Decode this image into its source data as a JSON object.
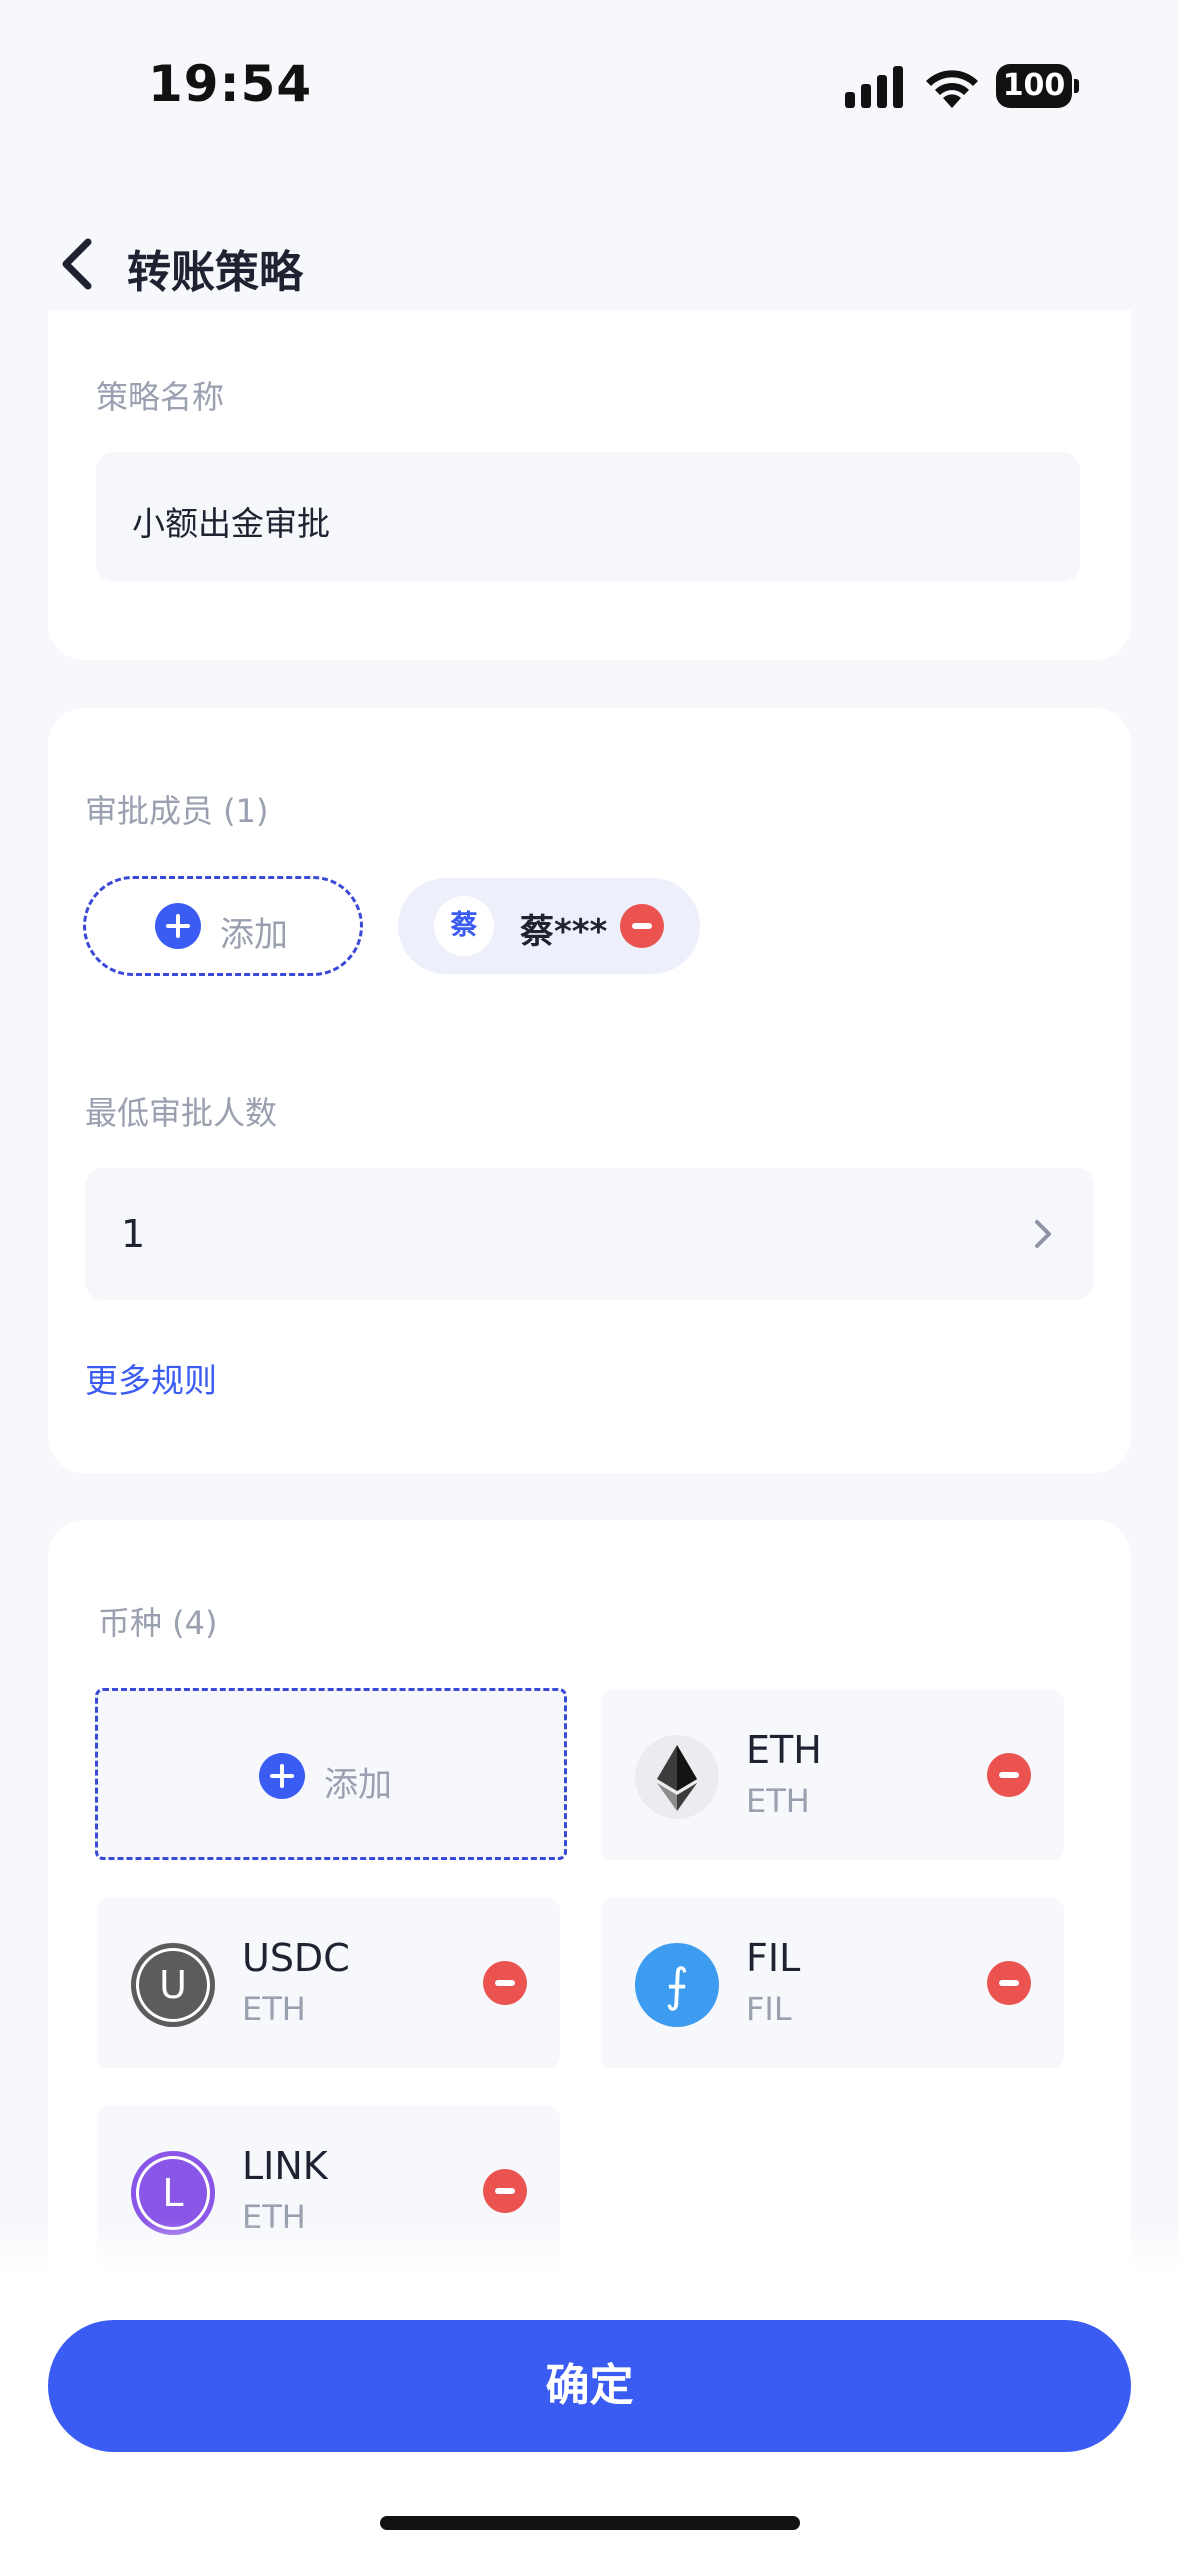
{
  "status_bar": {
    "time": "19:54",
    "battery": "100",
    "icons": [
      "signal-icon",
      "wifi-icon",
      "battery-icon"
    ]
  },
  "header": {
    "title": "转账策略",
    "back_icon": "chevron-left-icon"
  },
  "strategy_name": {
    "label": "策略名称",
    "value": "小额出金审批"
  },
  "approvers": {
    "label": "审批成员 (1)",
    "add_label": "添加",
    "members": [
      {
        "avatar_char": "蔡",
        "name": "蔡***"
      }
    ],
    "min_label": "最低审批人数",
    "min_value": "1",
    "more_rules": "更多规则"
  },
  "coins": {
    "label": "币种 (4)",
    "add_label": "添加",
    "items": [
      {
        "symbol": "ETH",
        "chain": "ETH",
        "icon": "ethereum-icon",
        "color": "#ececf0"
      },
      {
        "symbol": "USDC",
        "chain": "ETH",
        "icon": "usdc-icon",
        "letter": "U",
        "color": "#5c5c5c"
      },
      {
        "symbol": "FIL",
        "chain": "FIL",
        "icon": "filecoin-icon",
        "letter": "⨍",
        "color": "#3d9bf0"
      },
      {
        "symbol": "LINK",
        "chain": "ETH",
        "icon": "link-icon",
        "letter": "L",
        "color": "#8a56e8"
      }
    ]
  },
  "footer": {
    "confirm_label": "确定"
  },
  "colors": {
    "accent": "#3b5cf2",
    "danger": "#ea5350",
    "background": "#f7f8fc"
  }
}
